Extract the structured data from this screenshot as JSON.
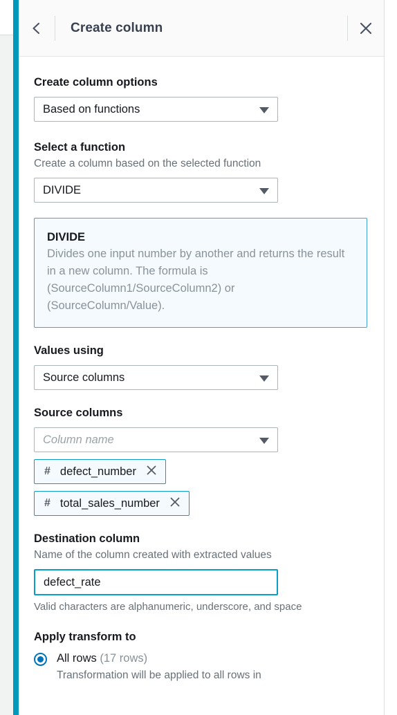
{
  "panel": {
    "header": {
      "title": "Create column",
      "back_icon": "chevron-left-icon",
      "close_icon": "close-icon"
    },
    "accent_color": "#0099bc",
    "link_color": "#0073bb"
  },
  "create_column_options": {
    "label": "Create column options",
    "value": "Based on functions",
    "caret_icon": "chevron-down-icon"
  },
  "select_function": {
    "label": "Select a function",
    "description": "Create a column based on the selected function",
    "value": "DIVIDE",
    "caret_icon": "chevron-down-icon"
  },
  "function_info": {
    "title": "DIVIDE",
    "text": "Divides one input number by another and returns the result in a new column. The formula is (SourceColumn1/SourceColumn2) or (SourceColumn/Value)."
  },
  "values_using": {
    "label": "Values using",
    "value": "Source columns",
    "caret_icon": "chevron-down-icon"
  },
  "source_columns": {
    "label": "Source columns",
    "placeholder": "Column name",
    "caret_icon": "chevron-down-icon",
    "chips": [
      {
        "type_icon": "#",
        "label": "defect_number",
        "remove_icon": "close-icon"
      },
      {
        "type_icon": "#",
        "label": "total_sales_number",
        "remove_icon": "close-icon"
      }
    ]
  },
  "destination_column": {
    "label": "Destination column",
    "description": "Name of the column created with extracted values",
    "value": "defect_rate",
    "hint": "Valid characters are alphanumeric, underscore, and space"
  },
  "apply_transform_to": {
    "label": "Apply transform to",
    "options": [
      {
        "label": "All rows",
        "count": "(17 rows)",
        "description": "Transformation will be applied to all rows in",
        "selected": true
      }
    ]
  }
}
